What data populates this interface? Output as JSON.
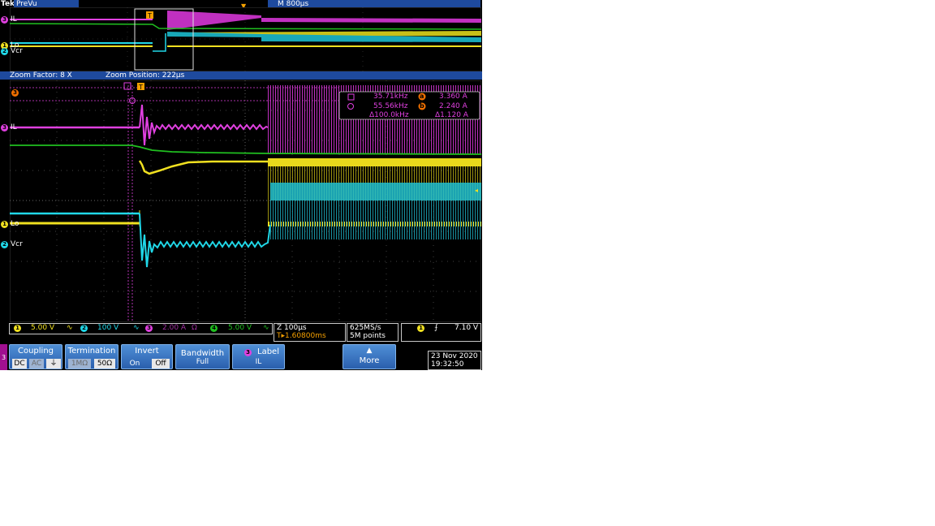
{
  "app": {
    "brand": "Tek",
    "mode": "PreVu",
    "timebase": "M 800µs",
    "trigger_mark": "T"
  },
  "zoom": {
    "factor_label": "Zoom Factor: 8 X",
    "position_label": "Zoom Position: 222µs"
  },
  "channels": {
    "ch3": {
      "num": "3",
      "label": "IL",
      "color": "#e040e0"
    },
    "ch1": {
      "num": "1",
      "label": "Lo",
      "color": "#f0e020"
    },
    "ch2": {
      "num": "2",
      "label": "Vcr",
      "color": "#20d8e8"
    },
    "ch4": {
      "num": "4",
      "color": "#20c020"
    }
  },
  "cursor_readout": {
    "a_freq": "35.71kHz",
    "a_mark": "a",
    "a_val": "3.360 A",
    "b_freq": "55.56kHz",
    "b_mark": "b",
    "b_val": "2.240 A",
    "d_freq": "Δ100.0kHz",
    "d_val": "Δ1.120 A"
  },
  "status": {
    "ch1_scale": "5.00 V",
    "ch2_scale": "100 V",
    "ch3_scale": "2.00 A",
    "ch3_unit": "Ω",
    "ch4_scale": "5.00 V",
    "zoom_time": "Z 100µs",
    "trig_pos": "T▸1.60800ms",
    "sample_rate": "625MS/s",
    "record_len": "5M points",
    "trig_ch": "1",
    "trig_level": "7.10 V"
  },
  "menu": {
    "side_num": "3",
    "coupling": {
      "title": "Coupling",
      "dc": "DC",
      "ac": "AC",
      "gnd": "⏚"
    },
    "termination": {
      "title": "Termination",
      "opt1": "1MΩ",
      "opt2": "50Ω"
    },
    "invert": {
      "title": "Invert",
      "on": "On",
      "off": "Off"
    },
    "bandwidth": {
      "title": "Bandwidth",
      "value": "Full"
    },
    "label": {
      "num": "3",
      "title": "Label",
      "value": "IL"
    },
    "more": {
      "arrow": "▲",
      "title": "More"
    }
  },
  "datetime": {
    "date": "23 Nov 2020",
    "time": "19:32:50"
  }
}
